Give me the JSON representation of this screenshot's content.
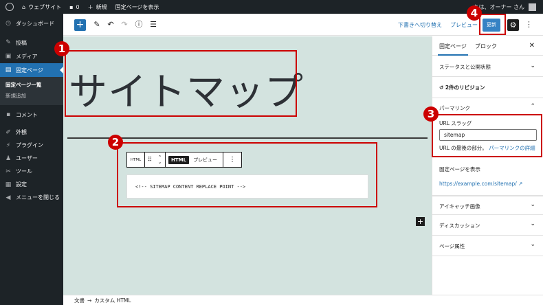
{
  "adminbar": {
    "site_name": "ウェブサイト",
    "comments_count": "0",
    "new_label": "新規",
    "view_page": "固定ページを表示",
    "greeting": "ちは、オーナー さん"
  },
  "sidebar": {
    "dashboard": "ダッシュボード",
    "posts": "投稿",
    "media": "メディア",
    "pages": "固定ページ",
    "pages_all": "固定ページ一覧",
    "pages_new": "新規追加",
    "comments": "コメント",
    "appearance": "外観",
    "plugins": "プラグイン",
    "users": "ユーザー",
    "tools": "ツール",
    "settings": "設定",
    "collapse": "メニューを閉じる"
  },
  "toolbar": {
    "save_draft": "下書きへ切り替え",
    "preview": "プレビュー",
    "update": "更新"
  },
  "canvas": {
    "page_title": "サイトマップ",
    "block_toolbar": {
      "html_icon_label": "HTML",
      "html_tab": "HTML",
      "preview_tab": "プレビュー"
    },
    "html_code": "<!-- SITEMAP CONTENT REPLACE POINT -->"
  },
  "settings_panel": {
    "tab_page": "固定ページ",
    "tab_block": "ブロック",
    "status": "ステータスと公開状態",
    "revisions": "2件のリビジョン",
    "permalink": "パーマリンク",
    "url_slug_label": "URL スラッグ",
    "url_slug_value": "sitemap",
    "url_last_part": "URL の最後の部分。",
    "permalink_details": "パーマリンクの詳細",
    "view_page_label": "固定ページを表示",
    "view_page_url": "https://example.com/sitemap/",
    "featured_image": "アイキャッチ画像",
    "discussion": "ディスカッション",
    "page_attributes": "ページ属性"
  },
  "footer": {
    "crumb_doc": "文書",
    "arrow": "→",
    "crumb_block": "カスタム HTML"
  },
  "annotations": {
    "n1": "1",
    "n2": "2",
    "n3": "3",
    "n4": "4"
  },
  "colors": {
    "accent": "#2271b1",
    "canvas_bg": "#d3e3df",
    "annotation": "#cc0000"
  }
}
